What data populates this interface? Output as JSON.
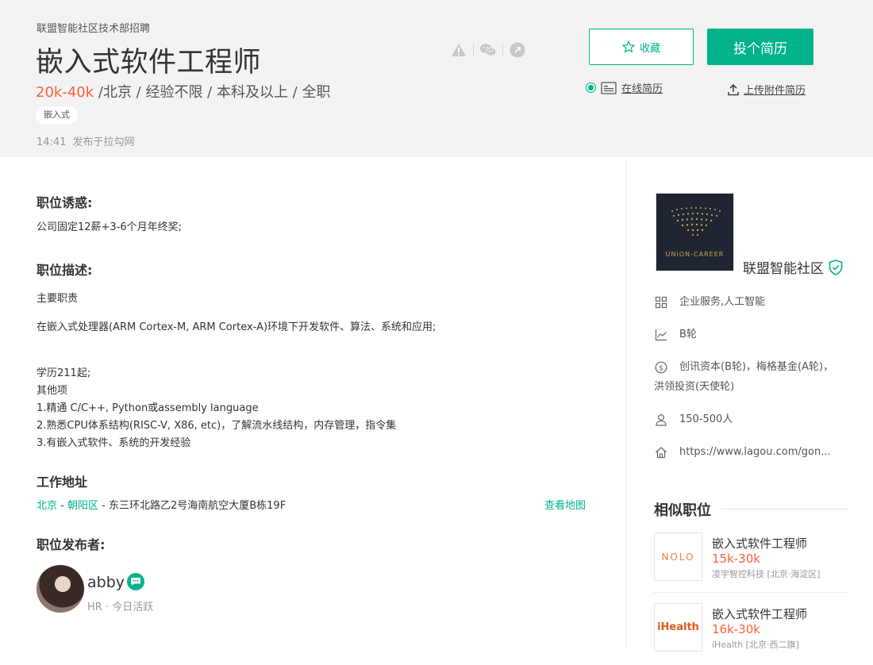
{
  "header": {
    "company_line": "联盟智能社区技术部招聘",
    "title": "嵌入式软件工程师",
    "salary": "20k-40k",
    "meta": " /北京 / 经验不限 / 本科及以上 / 全职",
    "tag": "嵌入式",
    "publish_time": "14:41",
    "publish_source": "发布于拉勾网",
    "fav_label": "收藏",
    "apply_label": "投个简历",
    "online_resume": "在线简历",
    "upload_resume": "上传附件简历",
    "icons": [
      "warning-icon",
      "wechat-icon",
      "share-icon"
    ]
  },
  "description": {
    "perks_title": "职位诱惑:",
    "perks_text": "公司固定12薪+3-6个月年终奖;",
    "desc_title": "职位描述:",
    "desc_lines": [
      "主要职责",
      "在嵌入式处理器(ARM  Cortex-M, ARM  Cortex-A)环境下开发软件、算法、系统和应用;",
      "学历211起;",
      "其他项",
      "1.精通 C/C++, Python或assembly language",
      "2.熟悉CPU体系结构(RISC-V, X86, etc)，了解流水线结构，内存管理，指令集",
      "3.有嵌入式软件、系统的开发经验"
    ],
    "address_title": "工作地址",
    "address_city": "北京",
    "address_district": "朝阳区",
    "address_detail": "东三环北路乙2号海南航空大厦B栋19F",
    "address_sep": " - ",
    "map_link": "查看地图",
    "publisher_title": "职位发布者:",
    "hr_name": "abby",
    "hr_sub": "HR · 今日活跃"
  },
  "company": {
    "logo_text": "UNION-CAREER",
    "name": "联盟智能社区",
    "industry": "企业服务,人工智能",
    "stage": "B轮",
    "investors_1": "创讯资本(B轮)，梅格基金(A轮)，",
    "investors_2": "洪领投资(天使轮)",
    "size": "150-500人",
    "website": "https://www.lagou.com/gon..."
  },
  "similar": {
    "title": "相似职位",
    "items": [
      {
        "logo": "NOLO",
        "job": "嵌入式软件工程师",
        "salary": "15k-30k",
        "company": "凌宇智控科技 [北京·海淀区]"
      },
      {
        "logo": "iHealth",
        "job": "嵌入式软件工程师",
        "salary": "16k-30k",
        "company": "iHealth [北京·西二旗]"
      }
    ]
  },
  "colors": {
    "accent": "#00b38a",
    "salary": "#fd5f39",
    "header_bg": "#f2f3f2"
  }
}
